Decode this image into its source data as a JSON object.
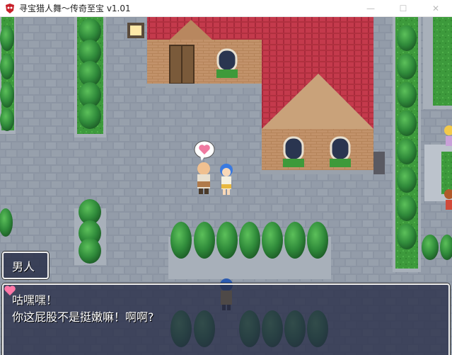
{
  "window": {
    "title": "寻宝猎人舞～传奇至宝 v1.01",
    "app_icon": "red-mask-icon",
    "controls": [
      "minimize-icon",
      "maximize-icon",
      "close-icon"
    ]
  },
  "dialogue": {
    "speaker": "男人",
    "line1": "咕嘿嘿！",
    "line1_icon": "heart-icon",
    "line2": "你这屁股不是挺嫩嘛！啊啊?",
    "continue_icon": "down-triangle-icon"
  },
  "scene": {
    "npc_emote": "heart-icon",
    "colors": {
      "roof": "#c23a4a",
      "brick_wall": "#b8875f",
      "cobblestone": "#8a93a0",
      "tree": "#2f8a3a",
      "window_bg": "#262c46"
    }
  }
}
